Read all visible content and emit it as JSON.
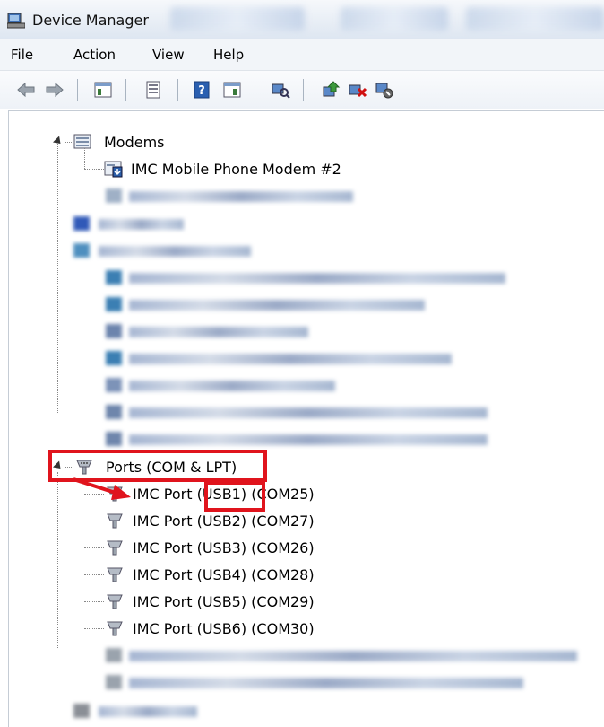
{
  "window": {
    "title": "Device Manager"
  },
  "menu": [
    {
      "label": "File"
    },
    {
      "label": "Action"
    },
    {
      "label": "View"
    },
    {
      "label": "Help"
    }
  ],
  "tree": {
    "modems_label": "Modems",
    "modem_item": "IMC Mobile Phone Modem #2",
    "ports_label": "Ports (COM & LPT)",
    "port_items": [
      {
        "prefix": "IMC Port ",
        "usb": "(USB1)",
        "com": " (COM25)"
      },
      {
        "label": "IMC Port (USB2) (COM27)"
      },
      {
        "label": "IMC Port (USB3) (COM26)"
      },
      {
        "label": "IMC Port (USB4) (COM28)"
      },
      {
        "label": "IMC Port (USB5) (COM29)"
      },
      {
        "label": "IMC Port (USB6) (COM30)"
      }
    ]
  },
  "annotation_color": "#e0141d"
}
